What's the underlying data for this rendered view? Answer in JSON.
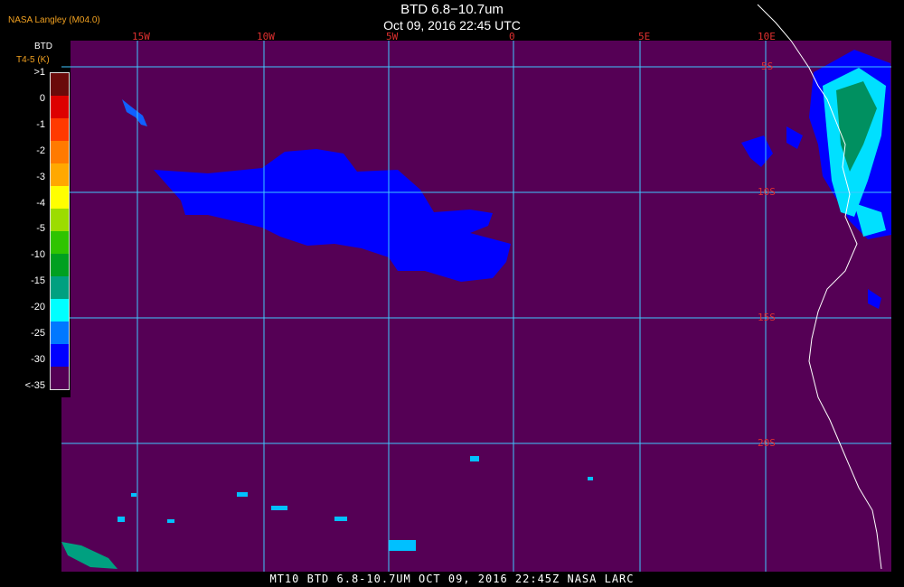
{
  "header": {
    "title": "BTD 6.8−10.7um",
    "datetime": "Oct 09, 2016 22:45 UTC",
    "source": "NASA Langley (M04.0)"
  },
  "legend": {
    "title": "BTD",
    "subtitle": "T4-5 (K)",
    "ticks": [
      ">1",
      "0",
      "-1",
      "-2",
      "-3",
      "-4",
      "-5",
      "-10",
      "-15",
      "-20",
      "-25",
      "-30",
      "<-35"
    ],
    "colors": [
      "#6a0a0a",
      "#dd0000",
      "#ff3a00",
      "#ff7a00",
      "#ffa800",
      "#ffff00",
      "#9cdc00",
      "#2fc400",
      "#00a020",
      "#00a080",
      "#00ffff",
      "#0078ff",
      "#0000ff",
      "#550055"
    ]
  },
  "map": {
    "background_color": "#550055",
    "grid_color": "#40c8ff",
    "label_color": "#e03030",
    "longitudes": [
      "15W",
      "10W",
      "5W",
      "0",
      "5E",
      "10E"
    ],
    "latitudes": [
      "5S",
      "10S",
      "15S",
      "20S"
    ],
    "coastline_color": "#ffffff"
  },
  "footer": {
    "caption": "MT10   BTD 6.8-10.7UM   OCT 09, 2016 22:45Z   NASA LARC"
  }
}
